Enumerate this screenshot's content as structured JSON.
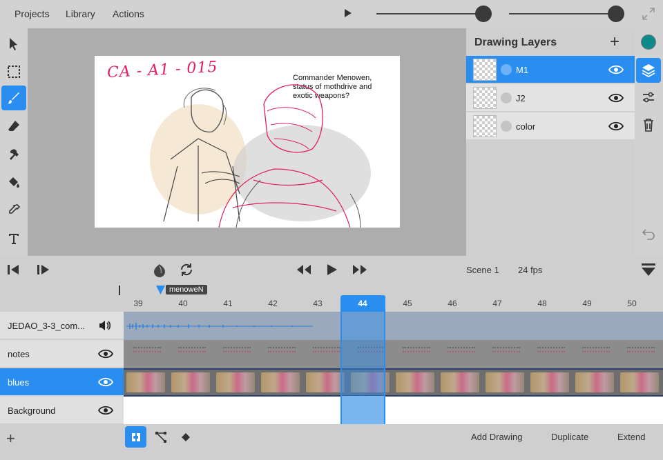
{
  "menu": {
    "projects": "Projects",
    "library": "Library",
    "actions": "Actions"
  },
  "sliders": [
    {
      "value": 1.0
    },
    {
      "value": 1.0
    }
  ],
  "artboard": {
    "scene_code": "CA - A1 - 015",
    "note": "Commander Menowen, status of mothdrive and exotic weapons?"
  },
  "layers_panel": {
    "title": "Drawing Layers",
    "layers": [
      {
        "name": "M1",
        "selected": true
      },
      {
        "name": "J2",
        "selected": false
      },
      {
        "name": "color",
        "selected": false
      }
    ]
  },
  "color": {
    "current": "#0e8a8a",
    "accent": "#2a8ef0"
  },
  "transport": {
    "scene": "Scene 1",
    "fps": "24 fps"
  },
  "timeline": {
    "marker": "menoweN",
    "frames": [
      "39",
      "40",
      "41",
      "42",
      "43",
      "44",
      "45",
      "46",
      "47",
      "48",
      "49",
      "50"
    ],
    "current_frame": "44",
    "tracks": [
      {
        "name": "JEDAO_3-3_com...",
        "kind": "audio",
        "selected": false
      },
      {
        "name": "notes",
        "kind": "drawing",
        "selected": false
      },
      {
        "name": "blues",
        "kind": "drawing",
        "selected": true
      },
      {
        "name": "Background",
        "kind": "drawing",
        "selected": false
      }
    ]
  },
  "bottom": {
    "add_drawing": "Add Drawing",
    "duplicate": "Duplicate",
    "extend": "Extend"
  },
  "icons": [
    "arrow-icon",
    "marquee-icon",
    "brush-icon",
    "eraser-icon",
    "smudge-icon",
    "fill-icon",
    "eyedropper-icon",
    "text-icon",
    "layers-icon",
    "sliders-icon",
    "trash-icon",
    "undo-icon",
    "onion-icon",
    "loop-icon",
    "rewind-icon",
    "play-icon",
    "fast-forward-icon",
    "step-back-icon",
    "step-forward-icon",
    "collapse-icon",
    "speaker-icon",
    "eye-icon",
    "magnet-icon",
    "path-icon",
    "keyframe-icon",
    "expand-icon"
  ]
}
